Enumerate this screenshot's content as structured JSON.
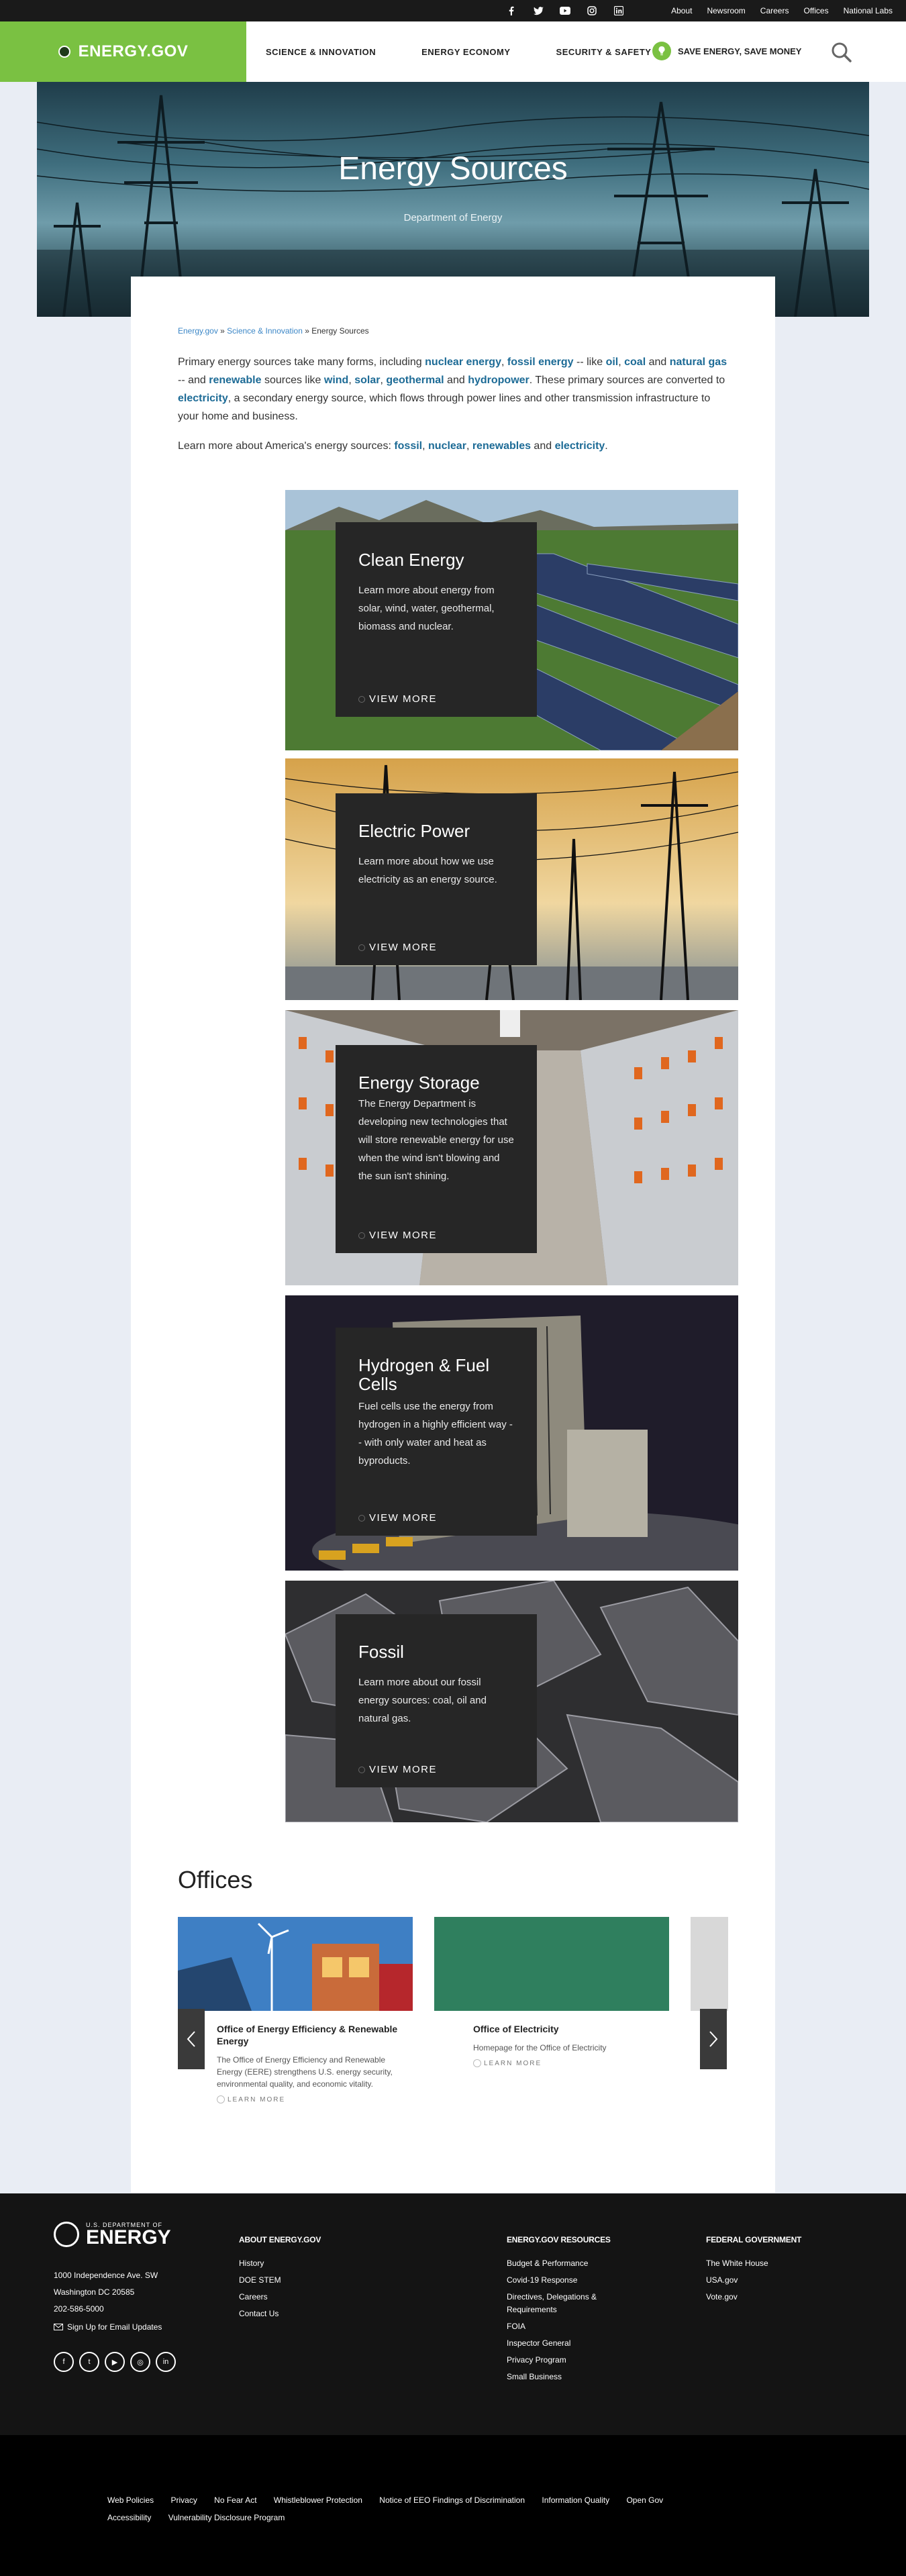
{
  "utility": {
    "socials": [
      "facebook-icon",
      "twitter-icon",
      "youtube-icon",
      "instagram-icon",
      "linkedin-icon"
    ],
    "links": [
      "About",
      "Newsroom",
      "Careers",
      "Offices",
      "National Labs"
    ]
  },
  "header": {
    "logo": "ENERGY.GOV",
    "nav": [
      "SCIENCE & INNOVATION",
      "ENERGY ECONOMY",
      "SECURITY & SAFETY"
    ],
    "save_energy": "SAVE ENERGY, SAVE MONEY"
  },
  "hero": {
    "title": "Energy Sources",
    "subtitle": "Department of Energy"
  },
  "breadcrumb": {
    "home": "Energy.gov",
    "sep1": " » ",
    "section": "Science & Innovation",
    "sep2": " » ",
    "current": "Energy Sources"
  },
  "intro": {
    "t1": "Primary energy sources take many forms, including ",
    "l1": "nuclear energy",
    "t2": ", ",
    "l2": "fossil energy",
    "t3": " -- like ",
    "l3": "oil",
    "t4": ", ",
    "l4": "coal",
    "t5": " and ",
    "l5": "natural gas",
    "t6": " -- and ",
    "l6": "renewable",
    "t7": " sources like ",
    "l7": "wind",
    "t8": ", ",
    "l8": "solar",
    "t9": ", ",
    "l9": "geothermal",
    "t10": " and ",
    "l10": "hydropower",
    "t11": ". These primary sources are converted to ",
    "l11": "electricity",
    "t12": ", a secondary energy source, which flows through power lines and other transmission infrastructure to your home and business."
  },
  "learn": {
    "t1": "Learn more about America's energy sources: ",
    "l1": "fossil",
    "t2": ", ",
    "l2": "nuclear",
    "t3": ", ",
    "l3": "renewables",
    "t4": " and ",
    "l4": "electricity",
    "t5": "."
  },
  "features": [
    {
      "title": "Clean Energy",
      "desc": "Learn more about energy from solar, wind, water, geothermal, biomass and nuclear.",
      "cta": "VIEW MORE"
    },
    {
      "title": "Electric Power",
      "desc": "Learn more about how we use electricity as an energy source.",
      "cta": "VIEW MORE"
    },
    {
      "title": "Energy Storage",
      "desc": "The Energy Department is developing new technologies that will store renewable energy for use when the wind isn't blowing and the sun isn't shining.",
      "cta": "VIEW MORE"
    },
    {
      "title": "Hydrogen & Fuel Cells",
      "desc": "Fuel cells use the energy from hydrogen in a highly efficient way -- with only water and heat as byproducts.",
      "cta": "VIEW MORE"
    },
    {
      "title": "Fossil",
      "desc": "Learn more about our fossil energy sources: coal, oil and natural gas.",
      "cta": "VIEW MORE"
    }
  ],
  "offices": {
    "title": "Offices",
    "cards": [
      {
        "title": "Office of Energy Efficiency & Renewable Energy",
        "desc": "The Office of Energy Efficiency and Renewable Energy (EERE) strengthens U.S. energy security, environmental quality, and economic vitality.",
        "cta": "LEARN MORE"
      },
      {
        "title": "Office of Electricity",
        "desc": "Homepage for the Office of Electricity",
        "cta": "LEARN MORE"
      }
    ]
  },
  "footer": {
    "logo_small": "U.S. DEPARTMENT OF",
    "logo_big": "ENERGY",
    "address1": "1000 Independence Ave. SW",
    "address2": "Washington DC 20585",
    "phone": "202-586-5000",
    "signup": "Sign Up for Email Updates",
    "socials": [
      "facebook-icon",
      "twitter-icon",
      "youtube-icon",
      "instagram-icon",
      "linkedin-icon"
    ],
    "col1": {
      "title": "ABOUT ENERGY.GOV",
      "links": [
        "History",
        "DOE STEM",
        "Careers",
        "Contact Us"
      ]
    },
    "col2": {
      "title": "ENERGY.GOV RESOURCES",
      "links": [
        "Budget & Performance",
        "Covid-19 Response",
        "Directives, Delegations & Requirements",
        "FOIA",
        "Inspector General",
        "Privacy Program",
        "Small Business"
      ]
    },
    "col3": {
      "title": "FEDERAL GOVERNMENT",
      "links": [
        "The White House",
        "USA.gov",
        "Vote.gov"
      ]
    }
  },
  "bottom_links": [
    "Web Policies",
    "Privacy",
    "No Fear Act",
    "Whistleblower Protection",
    "Notice of EEO Findings of Discrimination",
    "Information Quality",
    "Open Gov",
    "Accessibility",
    "Vulnerability Disclosure Program"
  ]
}
